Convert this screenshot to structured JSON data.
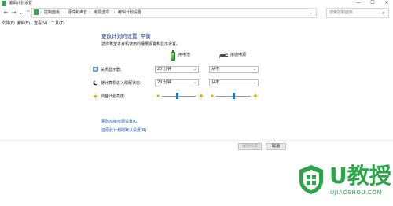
{
  "window": {
    "title": "编辑计划设置",
    "min": "—",
    "max": "☐",
    "close": "✕"
  },
  "nav": {
    "back": "←",
    "forward": "→",
    "recent": "⌄",
    "up": "↑",
    "breadcrumbs": [
      "控制面板",
      "硬件和声音",
      "电源选项",
      "编辑计划设置"
    ],
    "separator": "›",
    "dropdown": "⌄",
    "search_placeholder": "搜索控制面板",
    "search_icon": "⌕"
  },
  "menu": [
    "文件(F)",
    "编辑(E)",
    "查看(V)",
    "工具(T)"
  ],
  "main": {
    "heading": "更改计划的设置: 平衡",
    "subtext": "选择希望计算机使用的睡眠设置和显示设置。",
    "columns": [
      "用电池",
      "接通电源"
    ],
    "rows": [
      {
        "label": "关闭显示器:",
        "battery": "20 分钟",
        "plugged": "从不"
      },
      {
        "label": "使计算机进入睡眠状态:",
        "battery": "20 分钟",
        "plugged": "从不"
      }
    ],
    "brightness_label": "调整计划亮度:",
    "brightness": {
      "battery": 0.45,
      "plugged": 0.5
    },
    "select_arrow": "⌄",
    "links": [
      "更改高级电源设置(C)",
      "还原此计划的默认设置(R)"
    ]
  },
  "footer": {
    "save": "保存修改",
    "cancel": "取消"
  },
  "watermark": {
    "text": "U教授",
    "url": "UJIAOSHOU.COM"
  },
  "colors": {
    "heading": "#1e3287",
    "link": "#0a55b7",
    "accent": "#1a73c8",
    "watermark": "#2aa547"
  }
}
